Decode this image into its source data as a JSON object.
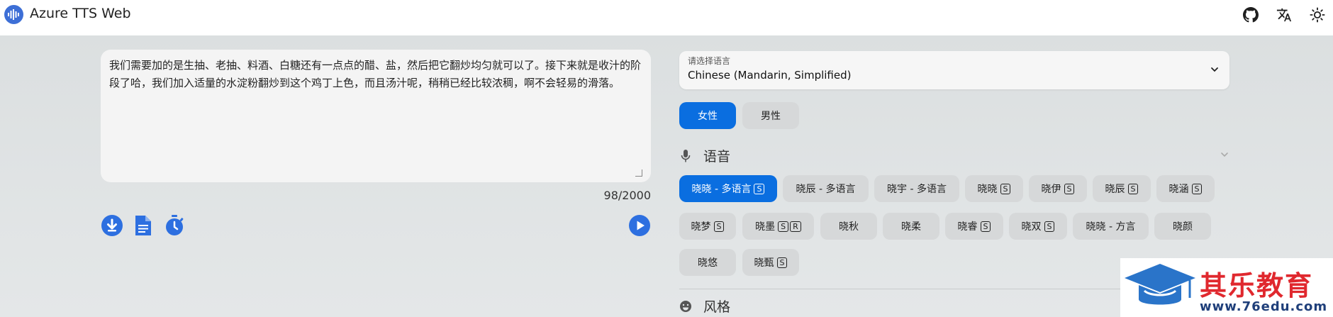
{
  "app": {
    "title": "Azure TTS Web"
  },
  "header": {
    "icons": [
      "github-icon",
      "translate-icon",
      "theme-toggle-icon"
    ]
  },
  "editor": {
    "text": "我们需要加的是生抽、老抽、料酒、白糖还有一点点的醋、盐，然后把它翻炒均匀就可以了。接下来就是收汁的阶段了哈，我们加入适量的水淀粉翻炒到这个鸡丁上色，而且汤汁呢，稍稍已经比较浓稠，啊不会轻易的滑落。",
    "char_count": "98/2000"
  },
  "actions": {
    "icons": [
      "download-icon",
      "document-icon",
      "timer-icon",
      "play-icon"
    ]
  },
  "language": {
    "label": "请选择语言",
    "value": "Chinese (Mandarin, Simplified)"
  },
  "gender": {
    "female": "女性",
    "male": "男性"
  },
  "voice_section": {
    "title": "语音",
    "voices": [
      {
        "label": "晓晓 - 多语言",
        "badges": [
          "S"
        ]
      },
      {
        "label": "晓辰 - 多语言",
        "badges": []
      },
      {
        "label": "晓宇 - 多语言",
        "badges": []
      },
      {
        "label": "晓晓",
        "badges": [
          "S"
        ]
      },
      {
        "label": "晓伊",
        "badges": [
          "S"
        ]
      },
      {
        "label": "晓辰",
        "badges": [
          "S"
        ]
      },
      {
        "label": "晓涵",
        "badges": [
          "S"
        ]
      },
      {
        "label": "晓梦",
        "badges": [
          "S"
        ]
      },
      {
        "label": "晓墨",
        "badges": [
          "S",
          "R"
        ]
      },
      {
        "label": "晓秋",
        "badges": []
      },
      {
        "label": "晓柔",
        "badges": []
      },
      {
        "label": "晓睿",
        "badges": [
          "S"
        ]
      },
      {
        "label": "晓双",
        "badges": [
          "S"
        ]
      },
      {
        "label": "晓晓 - 方言",
        "badges": []
      },
      {
        "label": "晓颜",
        "badges": []
      },
      {
        "label": "晓悠",
        "badges": []
      },
      {
        "label": "晓甄",
        "badges": [
          "S"
        ]
      }
    ]
  },
  "style_section": {
    "title": "风格"
  },
  "watermark": {
    "title": "其乐教育",
    "url": "www.76edu.com"
  },
  "colors": {
    "accent": "#0a6ee0",
    "button_bg": "#d6d8d9",
    "watermark_red": "#e0282e",
    "watermark_blue": "#1f3f7a"
  }
}
